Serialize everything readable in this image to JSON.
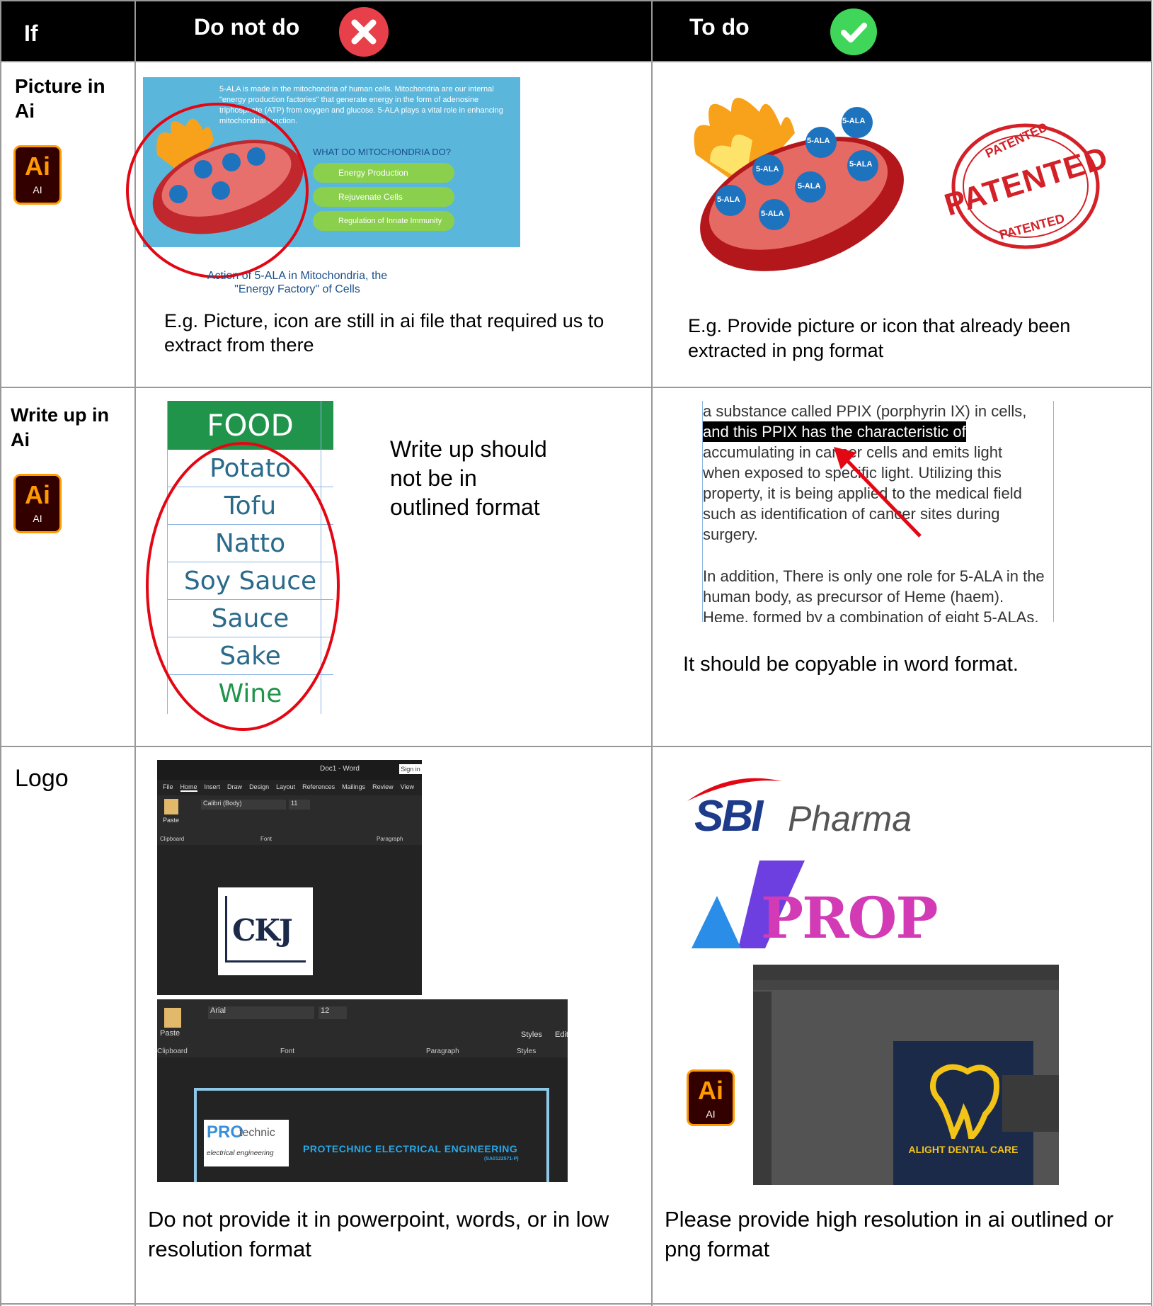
{
  "header": {
    "col_if": "If",
    "col_do_not": "Do not do",
    "col_to_do": "To do"
  },
  "row1": {
    "label": "Picture in Ai",
    "ai_label": "Ai",
    "ai_sub": "AI",
    "mock_text": "5-ALA is made in the mitochondria of human cells. Mitochondria are our internal \"energy production factories\" that generate energy in the form of adenosine triphosphate (ATP) from oxygen and glucose. 5-ALA plays a vital role in enhancing mitochondrial function.",
    "mock_question": "WHAT DO MITOCHONDRIA DO?",
    "mock_items": [
      "Energy Production",
      "Rejuvenate Cells",
      "Regulation of Innate Immunity"
    ],
    "mock_caption": "Action of 5-ALA in Mitochondria, the \"Energy Factory\" of Cells",
    "bubble_label": "5-ALA",
    "dont_text": "E.g. Picture, icon are still in ai file that required us to extract from there",
    "do_text": "E.g. Provide picture or icon that already been extracted in png format",
    "stamp_main": "PATENTED",
    "stamp_ring": "PATENTED"
  },
  "row2": {
    "label": "Write up in Ai",
    "ai_label": "Ai",
    "ai_sub": "AI",
    "food_header": "FOOD",
    "food_items": [
      "Potato",
      "Tofu",
      "Natto",
      "Soy Sauce",
      "Sauce",
      "Sake",
      "Wine"
    ],
    "dont_text": "Write up should not be in outlined format",
    "doc_lines": [
      "a substance called PPIX (porphyrin IX) in cells,",
      "and this PPIX has the characteristic of",
      "accumulating in cancer cells and emits light",
      "when exposed to specific light. Utilizing this",
      "property, it is being applied to the medical field",
      "such as identification of cancer sites during",
      "surgery.",
      "In addition, There is only one role for 5-ALA in the",
      "human body, as precursor of Heme (haem).",
      "Heme, formed by a combination of eight 5-ALAs,"
    ],
    "do_text": "It should be copyable in word format."
  },
  "row3": {
    "label": "Logo",
    "word_title": "Doc1 - Word",
    "sign_in": "Sign in",
    "word_tabs": [
      "File",
      "Home",
      "Insert",
      "Draw",
      "Design",
      "Layout",
      "References",
      "Mailings",
      "Review",
      "View"
    ],
    "font_name_1": "Calibri (Body)",
    "font_size_1": "11",
    "font_name_2": "Arial",
    "font_size_2": "12",
    "paste": "Paste",
    "clipboard": "Clipboard",
    "font_group": "Font",
    "paragraph_group": "Paragraph",
    "styles": "Styles",
    "edit": "Edit",
    "ckj": "CKJ",
    "pro_logo_1": "PRO",
    "pro_logo_2": "technic",
    "pro_logo_3": "electrical engineering",
    "pro_company": "PROTECHNIC ELECTRICAL ENGINEERING",
    "pro_reg": "(SA0122571-P)",
    "dont_text": "Do not provide it in powerpoint, words, or in low resolution format",
    "sbi_1": "SBI",
    "sbi_2": "Pharma",
    "prop_text": "PROP",
    "ai_label": "Ai",
    "ai_sub": "AI",
    "dental_text": "ALIGHT DENTAL CARE",
    "do_text": "Please provide high resolution in ai outlined or png format"
  },
  "colors": {
    "header_bg": "#000000",
    "red_x": "#e8404b",
    "green_check": "#3fd65a",
    "grid": "#999999"
  }
}
